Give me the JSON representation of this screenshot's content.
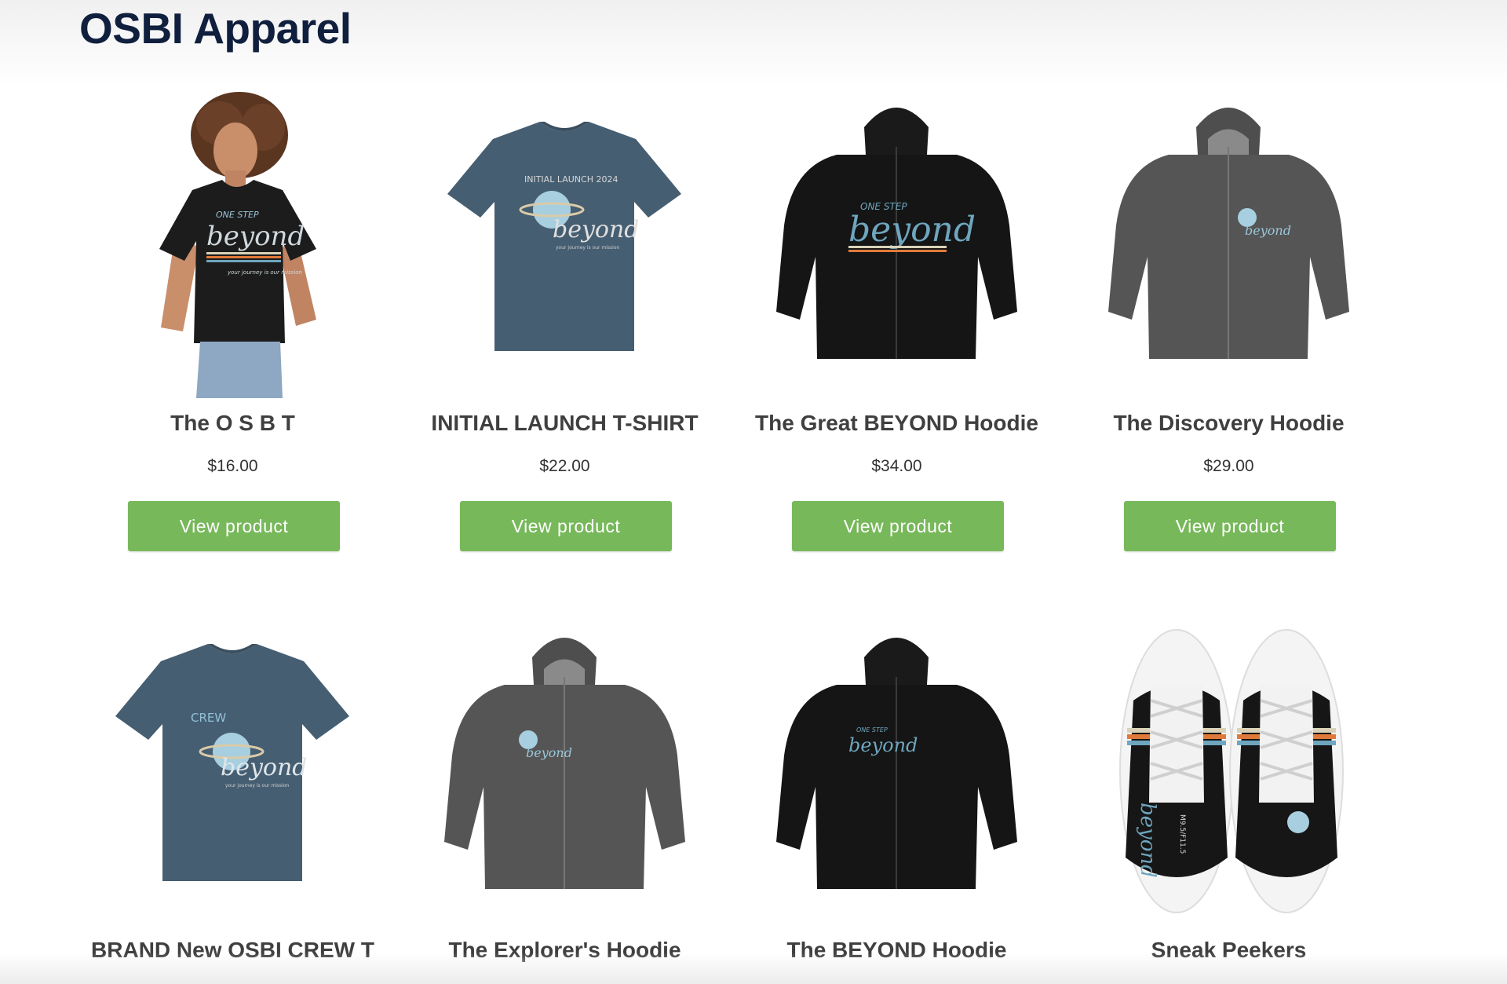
{
  "page": {
    "title": "OSBI Apparel"
  },
  "ui": {
    "view_label": "View product"
  },
  "products": [
    {
      "name": "The O S B T",
      "price": "$16.00",
      "image": "model-black-tshirt",
      "print": {
        "top": "ONE STEP",
        "main": "beyond",
        "tag": "your journey is our mission"
      }
    },
    {
      "name": "INITIAL LAUNCH T-SHIRT",
      "price": "$22.00",
      "image": "blue-tshirt",
      "print": {
        "top": "INITIAL LAUNCH 2024",
        "main": "beyond",
        "tag": "your journey is our mission"
      }
    },
    {
      "name": "The Great BEYOND Hoodie",
      "price": "$34.00",
      "image": "black-hoodie",
      "print": {
        "top": "ONE STEP",
        "main": "beyond"
      }
    },
    {
      "name": "The Discovery Hoodie",
      "price": "$29.00",
      "image": "gray-hoodie",
      "print": {
        "main": "beyond"
      }
    },
    {
      "name": "BRAND New OSBI CREW T",
      "image": "blue-tshirt",
      "print": {
        "top": "CREW",
        "main": "beyond",
        "tag": "your journey is our mission"
      }
    },
    {
      "name": "The Explorer's Hoodie",
      "image": "gray-hoodie",
      "print": {
        "main": "beyond"
      }
    },
    {
      "name": "The BEYOND Hoodie",
      "image": "black-hoodie",
      "print": {
        "top": "ONE STEP",
        "main": "beyond"
      }
    },
    {
      "name": "Sneak Peekers",
      "image": "sneakers",
      "print": {
        "main": "beyond",
        "size": "M9.5/F11.5"
      }
    }
  ],
  "colors": {
    "button": "#77b85a",
    "title": "#0f1f3d",
    "print_blue": "#6fa6bf"
  }
}
